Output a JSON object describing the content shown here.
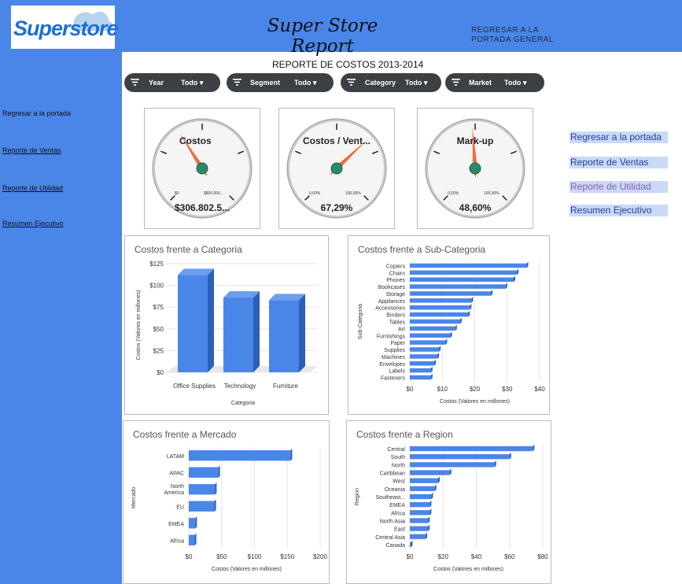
{
  "header": {
    "logo_text": "Superstore",
    "title": "Super Store Report",
    "link_line1": "REGRESAR A LA",
    "link_line2": "PORTADA GENERAL"
  },
  "sidebar": {
    "items": [
      {
        "label": "Regresar a la portada"
      },
      {
        "label": "Reporte de Ventas"
      },
      {
        "label": "Reporte de  Utilidad"
      },
      {
        "label": "Resumen Ejecutivo"
      }
    ]
  },
  "main": {
    "title": "REPORTE DE COSTOS 2013-2014"
  },
  "filters": [
    {
      "label": "Year",
      "value": "Todo"
    },
    {
      "label": "Segment",
      "value": "Todo"
    },
    {
      "label": "Category",
      "value": "Todo"
    },
    {
      "label": "Market",
      "value": "Todo"
    }
  ],
  "gauges": [
    {
      "label": "Costos",
      "value": "$306.802.5...",
      "min": "$0",
      "max": "$800.000...",
      "fraction": 0.38
    },
    {
      "label": "Costos / Vent...",
      "value": "67,29%",
      "min": "0,00%",
      "max": "100,00%",
      "fraction": 0.6729
    },
    {
      "label": "Mark-up",
      "value": "48,60%",
      "min": "0,00%",
      "max": "100,00%",
      "fraction": 0.486
    }
  ],
  "right_links": [
    {
      "label": "Regresar a la portada",
      "color": "#1f3f99"
    },
    {
      "label": "Reporte de Ventas",
      "color": "#1f3f99"
    },
    {
      "label": "Reporte de  Utilidad",
      "color": "#8e5bb5"
    },
    {
      "label": "Resumen Ejecutivo",
      "color": "#1f3f99"
    }
  ],
  "colors": {
    "header": "#4a86e8",
    "bar": "#4a86e8",
    "needle": "#ef6c3e",
    "hub": "#2a8a6a",
    "filter": "#3c3f44"
  },
  "chart_data": [
    {
      "type": "bar",
      "title": "Costos frente a Categoria",
      "xlabel": "Categoria",
      "ylabel": "Costos (Valores en millones)",
      "categories": [
        "Office Supplies",
        "Technology",
        "Furniture"
      ],
      "values": [
        112,
        86,
        83
      ],
      "ylim": [
        0,
        125
      ],
      "yticks": [
        "$0",
        "$25",
        "$50",
        "$75",
        "$100",
        "$125"
      ]
    },
    {
      "type": "bar",
      "orientation": "horizontal",
      "title": "Costos frente a Sub-Categoria",
      "xlabel": "Costos (Valores en millones)",
      "ylabel": "Sub-Categoria",
      "categories": [
        "Copiers",
        "Chairs",
        "Phones",
        "Bookcases",
        "Storage",
        "Appliances",
        "Accessories",
        "Binders",
        "Tables",
        "Art",
        "Furnishings",
        "Paper",
        "Supplies",
        "Machines",
        "Envelopes",
        "Labels",
        "Fasteners"
      ],
      "values": [
        36,
        33,
        32,
        29.5,
        25,
        19,
        18.5,
        18,
        15.5,
        14,
        12.5,
        11,
        9,
        8.5,
        7.5,
        6.5,
        6.5
      ],
      "xlim": [
        0,
        40
      ],
      "xticks": [
        "$0",
        "$10",
        "$20",
        "$30",
        "$40"
      ]
    },
    {
      "type": "bar",
      "orientation": "horizontal",
      "title": "Costos frente a Mercado",
      "xlabel": "Costos (Valores en millones)",
      "ylabel": "Mercado",
      "categories": [
        "LATAM",
        "APAC",
        "North America",
        "EU",
        "EMEA",
        "Africa"
      ],
      "values": [
        155,
        45,
        40,
        39,
        10,
        9
      ],
      "xlim": [
        0,
        200
      ],
      "xticks": [
        "$0",
        "$50",
        "$100",
        "$150",
        "$200"
      ]
    },
    {
      "type": "bar",
      "orientation": "horizontal",
      "title": "Costos frente a Region",
      "xlabel": "Costos (Valores en millones)",
      "ylabel": "Region",
      "categories": [
        "Central",
        "South",
        "North",
        "Caribbean",
        "West",
        "Oceania",
        "Southeast...",
        "EMEA",
        "Africa",
        "North Asia",
        "East",
        "Central Asia",
        "Canada"
      ],
      "values": [
        74,
        60,
        51,
        24,
        17,
        15,
        13,
        12,
        12,
        11,
        11,
        9.5,
        0.7
      ],
      "xlim": [
        0,
        80
      ],
      "xticks": [
        "$0",
        "$20",
        "$40",
        "$60",
        "$80"
      ]
    }
  ]
}
